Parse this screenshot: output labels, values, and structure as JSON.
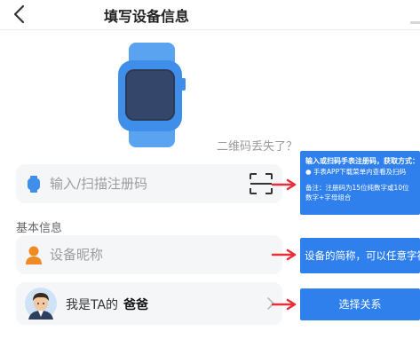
{
  "header": {
    "title": "填写设备信息"
  },
  "qr_lost_link": "二维码丢失了？",
  "registration": {
    "placeholder": "输入/扫描注册码"
  },
  "section_basic_info": "基本信息",
  "nickname": {
    "placeholder": "设备昵称"
  },
  "relation": {
    "prefix": "我是TA的",
    "value": "爸爸"
  },
  "callouts": {
    "registration_help": {
      "title": "输入或扫码手表注册码，获取方式：",
      "bullet": "● 手表APP下载菜单内查看及扫码",
      "note": "备注：注册码为15位纯数字或10位数字+字母组合"
    },
    "nickname_help": "设备的简称，可以任意字符",
    "relation_help": "选择关系"
  },
  "colors": {
    "accent_blue": "#2f80ed",
    "watch_blue": "#3f8ee9",
    "arrow_red": "#e8303a",
    "person_orange": "#f08a24"
  }
}
